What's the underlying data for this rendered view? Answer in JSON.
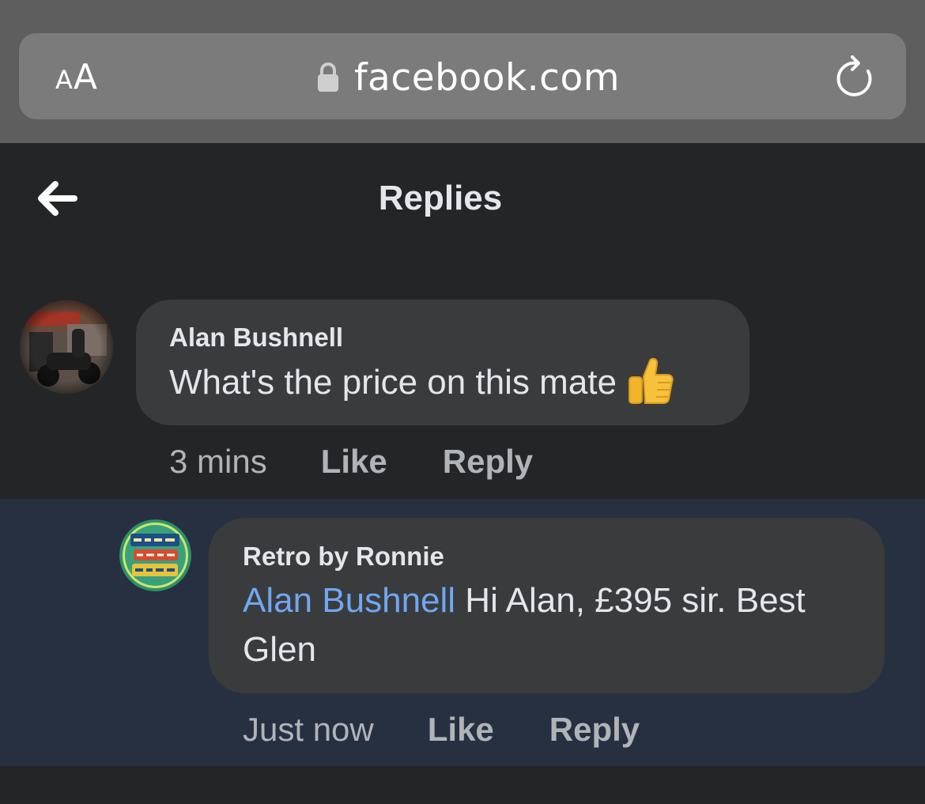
{
  "browser": {
    "text_size_small": "A",
    "text_size_big": "A",
    "url": "facebook.com",
    "icons": [
      "lock-icon",
      "reload-icon"
    ]
  },
  "header": {
    "title": "Replies",
    "back_icon": "back-arrow-icon"
  },
  "comments": [
    {
      "author": "Alan Bushnell",
      "text": "What's the price on this mate",
      "emoji": "thumbs-up",
      "time": "3 mins",
      "like_label": "Like",
      "reply_label": "Reply"
    },
    {
      "author": "Retro by Ronnie",
      "mention": "Alan Bushnell",
      "text_line1": " Hi Alan, £395 sir. Best",
      "text_line2": "Glen",
      "time": "Just now",
      "like_label": "Like",
      "reply_label": "Reply"
    }
  ],
  "colors": {
    "page_bg": "#242526",
    "highlight_bg": "#263040",
    "bubble_bg": "#3a3b3c",
    "mention": "#6fa7f2",
    "browser_bar": "#5e5e5e"
  }
}
